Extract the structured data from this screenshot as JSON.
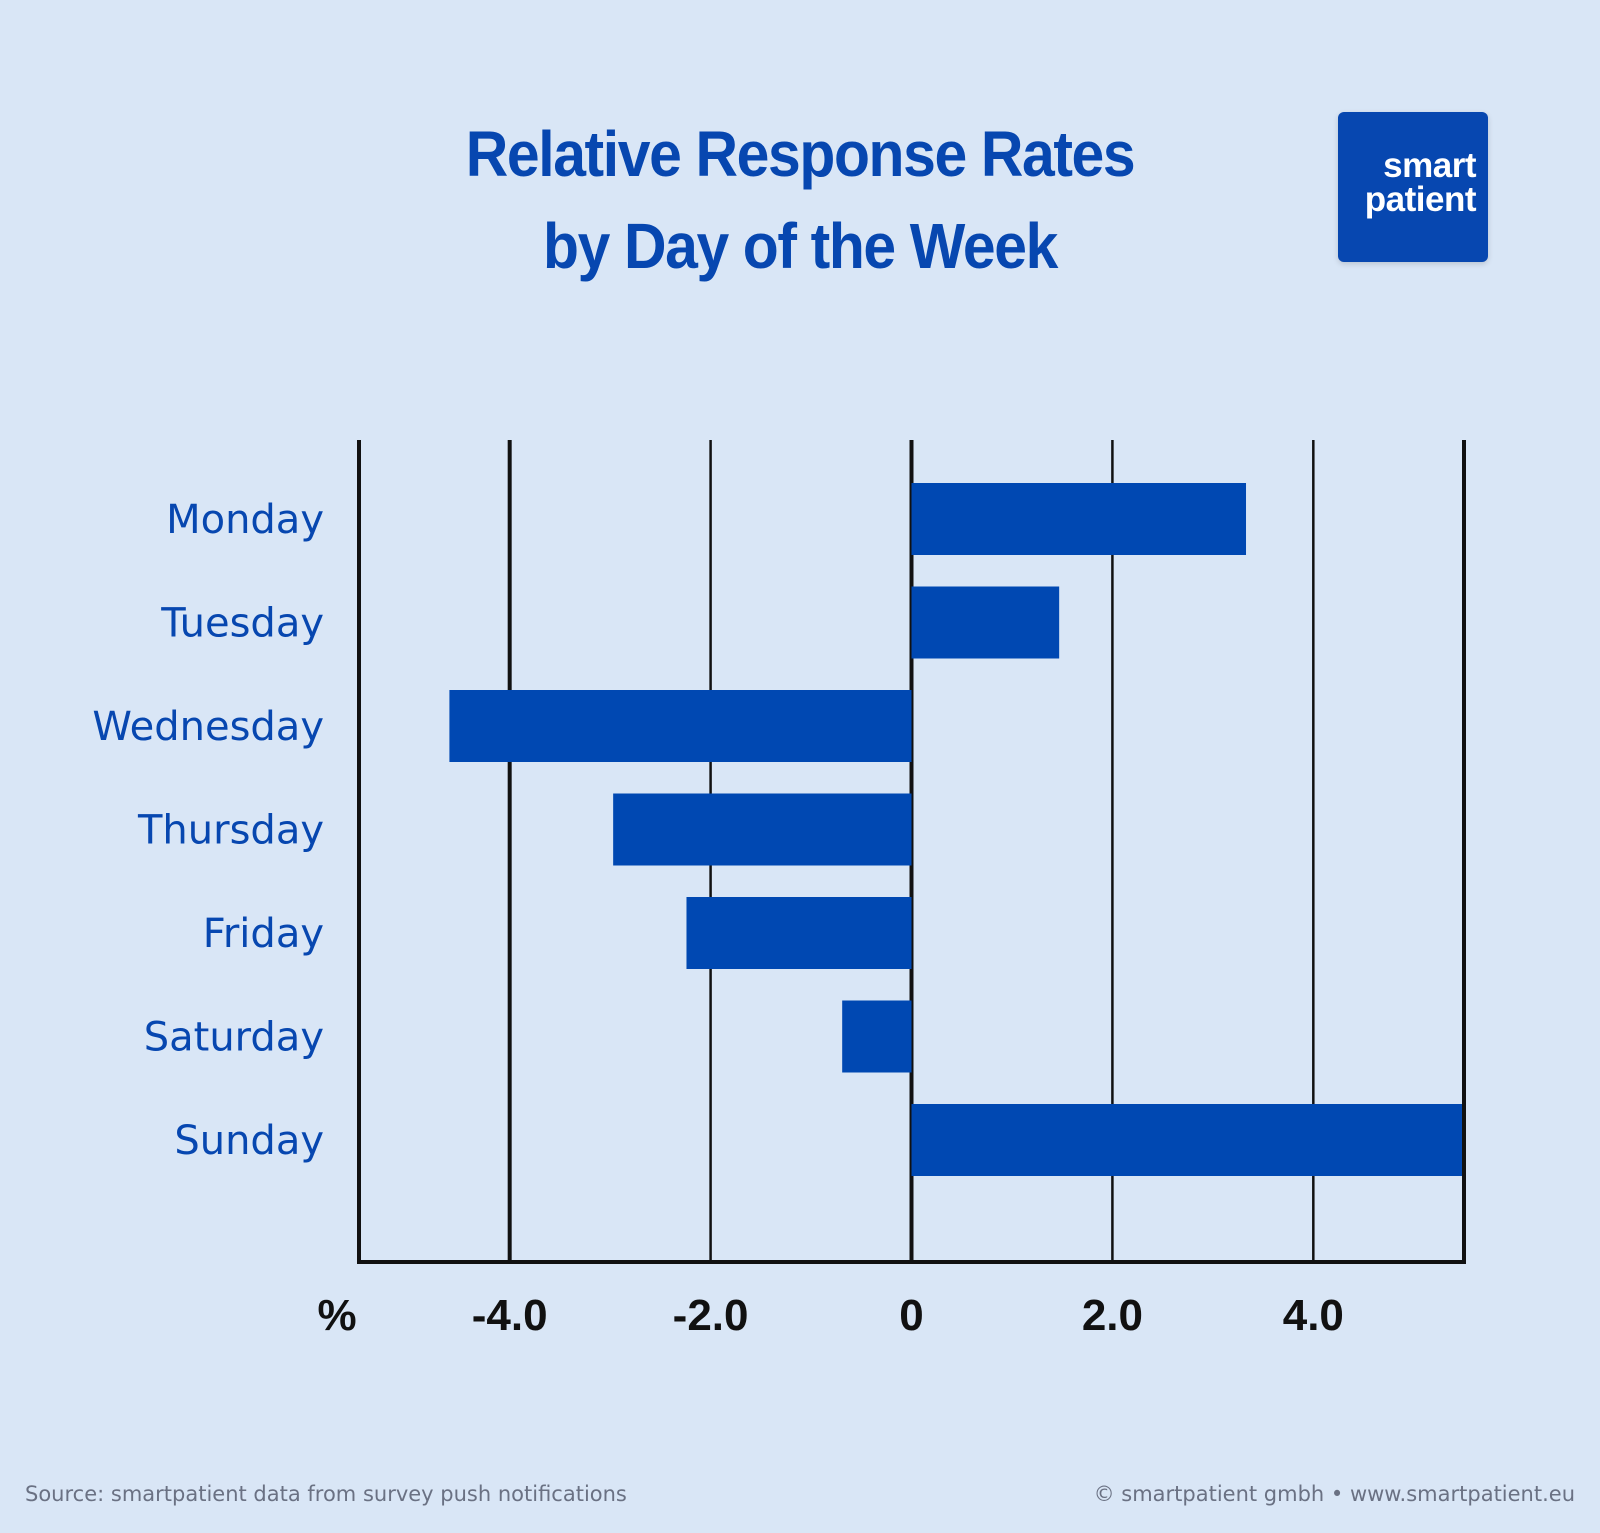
{
  "header": {
    "title_line1": "Relative Response Rates",
    "title_line2": "by Day of the Week"
  },
  "logo": {
    "line1": "smart",
    "line2": "patient"
  },
  "colors": {
    "background": "#d9e6f6",
    "bar": "#0048b2",
    "accent": "#0747b0",
    "axis": "#111111"
  },
  "footer": {
    "source": "Source: smartpatient data from survey push notifications",
    "copyright": "© smartpatient gmbh • www.smartpatient.eu"
  },
  "chart_data": {
    "type": "bar",
    "orientation": "horizontal",
    "title": "Relative Response Rates by Day of the Week",
    "xlabel": "%",
    "ylabel": "",
    "categories": [
      "Monday",
      "Tuesday",
      "Wednesday",
      "Thursday",
      "Friday",
      "Saturday",
      "Sunday"
    ],
    "values": [
      3.33,
      1.47,
      -4.6,
      -2.97,
      -2.24,
      -0.69,
      5.48
    ],
    "xlim": [
      -5.5,
      5.5
    ],
    "xticks": [
      -4.0,
      -2.0,
      0,
      2.0,
      4.0
    ],
    "xtick_labels": [
      "-4.0",
      "-2.0",
      "0",
      "2.0",
      "4.0"
    ],
    "grid": true,
    "legend": "none"
  }
}
